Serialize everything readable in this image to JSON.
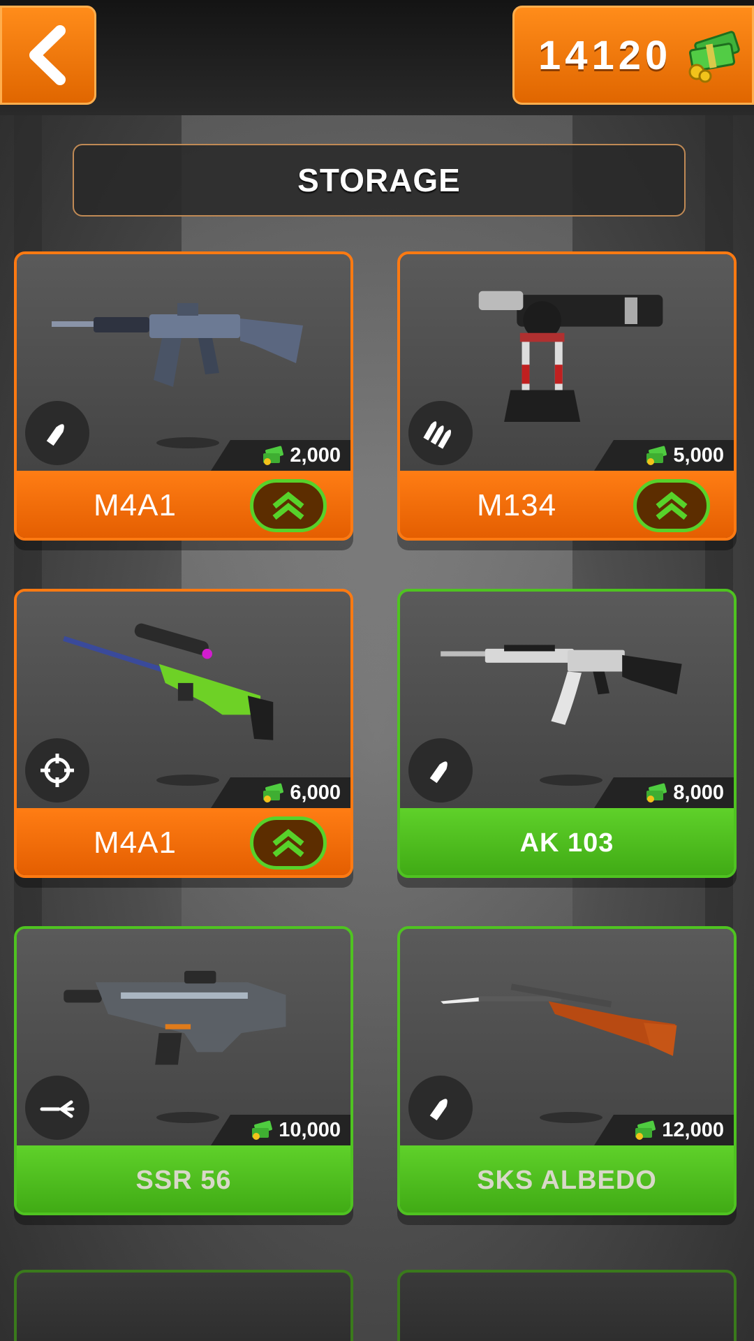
{
  "header": {
    "currency": "14120",
    "title": "STORAGE"
  },
  "colors": {
    "accent_orange": "#ff7d14",
    "accent_green": "#4fc321",
    "upgrade_ring": "#57d22a"
  },
  "weapons": [
    {
      "name": "M4A1",
      "price": "2,000",
      "state": "upgradeable",
      "type_icon": "bullet-icon",
      "weapon_icon": "assault-rifle-icon"
    },
    {
      "name": "M134",
      "price": "5,000",
      "state": "upgradeable",
      "type_icon": "triple-bullet-icon",
      "weapon_icon": "minigun-turret-icon"
    },
    {
      "name": "M4A1",
      "price": "6,000",
      "state": "upgradeable",
      "type_icon": "crosshair-icon",
      "weapon_icon": "sniper-rifle-icon"
    },
    {
      "name": "AK 103",
      "price": "8,000",
      "state": "locked",
      "type_icon": "bullet-icon",
      "weapon_icon": "ak-rifle-icon"
    },
    {
      "name": "SSR 56",
      "price": "10,000",
      "state": "locked",
      "type_icon": "spread-shot-icon",
      "weapon_icon": "scifi-rifle-icon"
    },
    {
      "name": "SKS ALBEDO",
      "price": "12,000",
      "state": "locked",
      "type_icon": "bullet-icon",
      "weapon_icon": "sks-bayonet-rifle-icon"
    }
  ]
}
